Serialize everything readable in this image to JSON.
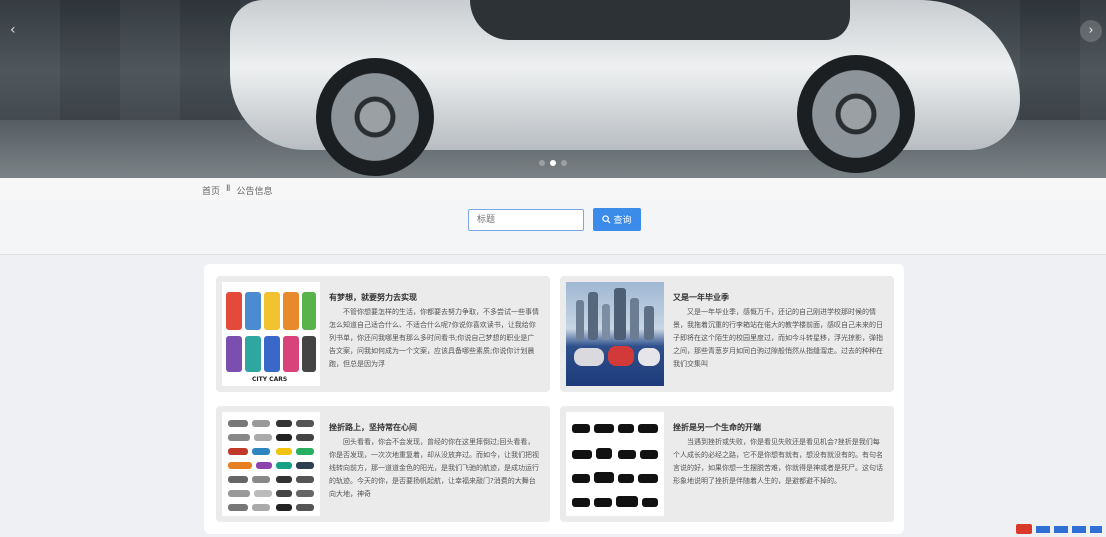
{
  "banner": {
    "prev_icon": "‹",
    "next_icon": "›",
    "slides": 3,
    "active_slide": 2
  },
  "breadcrumb": {
    "home": "首页",
    "separator": "Ⅱ",
    "current": "公告信息"
  },
  "search": {
    "placeholder": "标题",
    "button_icon": "search-icon",
    "button_label": "查询",
    "accent": "#3b8beb"
  },
  "notices": [
    {
      "title": "有梦想，就要努力去实现",
      "thumb_label": "CITY CARS",
      "desc": "不管你想要怎样的生活，你都要去努力争取，不多尝试一些事情怎么知道自己适合什么、不适合什么呢?你说你喜欢读书，让我给你列书单，你还问我哪里有那么多时间看书;你说自己梦想的职业是广告文案，问我如何成为一个文案，应该具备哪些素质;你说你计划晨跑，但总是因为浮"
    },
    {
      "title": "又是一年毕业季",
      "thumb_label": "",
      "desc": "又是一年毕业季，感慨万千，还记的自己刚进学校那时候的情景，我拖着沉重的行李箱站在偌大的教学楼前面，感叹自己未来的日子即将在这个陌生的校园里度过，而如今斗转星移，浮光掠影，弹指之间，那些青葱岁月如同白驹过隙般悄然从指缝溜走。过去的种种在我们交集叫"
    },
    {
      "title": "挫折路上，坚持常在心间",
      "thumb_label": "",
      "desc": "回头看看，你会不会发现，曾经的你在这里摔倒过;回头看看，你是否发现，一次次地重复着，却从没放弃过。而如今，让我们把视线转向前方，那一道道金色的阳光，是我们飞驰的航迹，是成功运行的轨迹。今天的你，是否要扬帆起航，让幸福来敲门?消费的大舞台向大地，神奇"
    },
    {
      "title": "挫折是另一个生命的开端",
      "thumb_label": "",
      "desc": "当遇到挫折或失败，你是看见失败还是看见机会?挫折是我们每个人成长的必经之路，它不是你想有就有，想没有就没有的。有句名言说的好，如果你想一生摆脱苦难，你就得是神或者是死尸。这句话形象地说明了挫折是伴随着人生的，是避都避不掉的。"
    }
  ]
}
